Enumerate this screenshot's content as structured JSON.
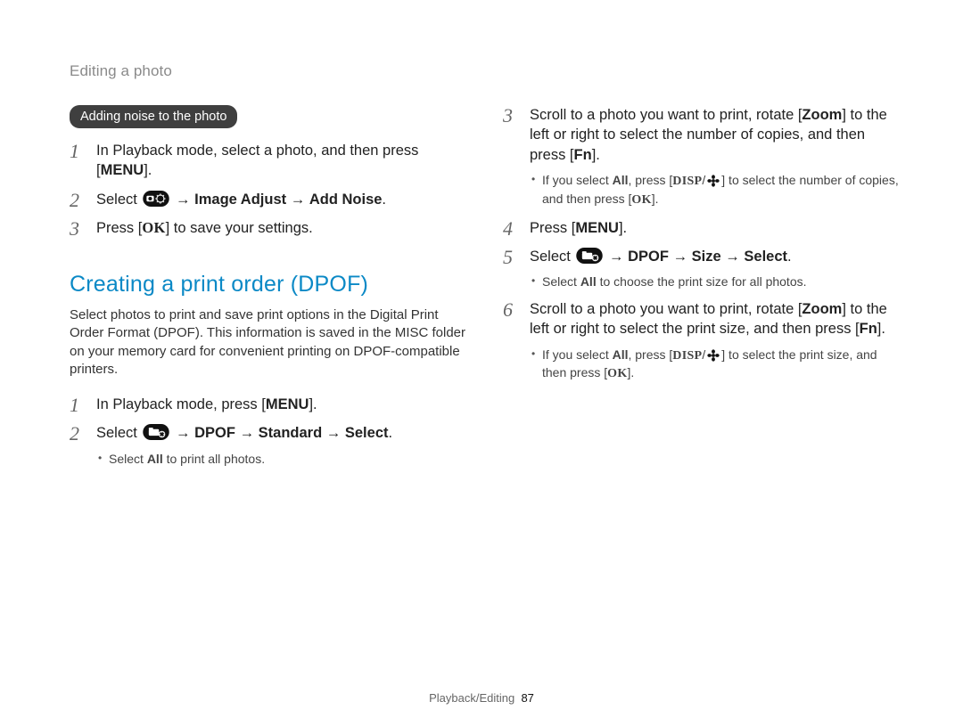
{
  "page_title": "Editing a photo",
  "left": {
    "pill": "Adding noise to the photo",
    "steps": [
      {
        "prefix": "In Playback mode, select a photo, and then press [",
        "key": "MENU",
        "suffix": "]."
      },
      {
        "type": "select-chain",
        "chain": [
          "Image Adjust",
          "Add Noise"
        ],
        "trailing": "."
      },
      {
        "type": "press-save",
        "prefix": "Press [",
        "icon": "ok",
        "suffix": "] to save your settings."
      }
    ],
    "section_title": "Creating a print order (DPOF)",
    "section_intro": "Select photos to print and save print options in the Digital Print Order Format (DPOF). This information is saved in the MISC folder on your memory card for convenient printing on DPOF-compatible printers.",
    "steps2": [
      {
        "type": "press",
        "prefix": "In Playback mode, press [",
        "key": "MENU",
        "suffix": "]."
      },
      {
        "type": "select-chain",
        "chain": [
          "DPOF",
          "Standard",
          "Select"
        ],
        "trailing": ".",
        "sub": [
          {
            "t": "Select ",
            "b": "All",
            "t2": " to print all photos."
          }
        ]
      }
    ]
  },
  "right": {
    "start": 3,
    "steps": [
      {
        "type": "rich3",
        "parts": [
          "Scroll to a photo you want to print, rotate [",
          "Zoom",
          "] to the left or right to select the number of copies, and then press [",
          "Fn",
          "]."
        ],
        "sub": [
          {
            "prefix": "If you select ",
            "b": "All",
            "mid": ", press [",
            "icons": [
              "disp",
              "flower"
            ],
            "suffix": "] to select the number of copies, and then press [",
            "icon2": "ok",
            "tail": "]."
          }
        ]
      },
      {
        "type": "press",
        "prefix": "Press [",
        "key": "MENU",
        "suffix": "]."
      },
      {
        "type": "select-chain",
        "chain": [
          "DPOF",
          "Size",
          "Select"
        ],
        "trailing": ".",
        "sub": [
          {
            "t": "Select ",
            "b": "All",
            "t2": " to choose the print size for all photos."
          }
        ]
      },
      {
        "type": "rich6",
        "parts": [
          "Scroll to a photo you want to print, rotate [",
          "Zoom",
          "] to the left or right to select the print size, and then press [",
          "Fn",
          "]."
        ],
        "sub": [
          {
            "prefix": "If you select ",
            "b": "All",
            "mid": ", press [",
            "icons": [
              "disp",
              "flower"
            ],
            "suffix": "] to select the print size, and then press [",
            "icon2": "ok",
            "tail": "]."
          }
        ]
      }
    ]
  },
  "footer": {
    "section": "Playback/Editing",
    "page": "87"
  }
}
